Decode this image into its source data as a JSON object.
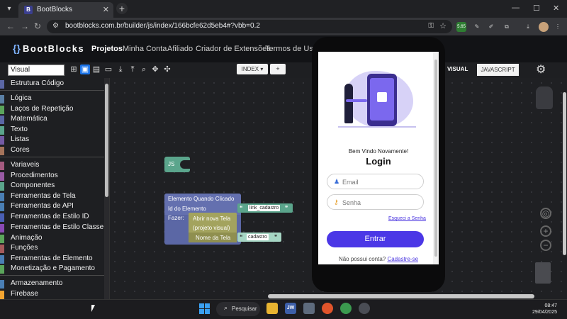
{
  "browser": {
    "tab_title": "BootBlocks",
    "favicon_letter": "B",
    "url": "bootblocks.com.br/builder/js/index/166bcfe62d5eb4#?vbb=0.2",
    "extension_badge": "5.65"
  },
  "header": {
    "brand": "BootBlocks",
    "menu": [
      "Projetos",
      "Minha Conta",
      "Afiliado",
      "Criador de Extensões",
      "Termos de Uso"
    ]
  },
  "toolbar": {
    "mode_value": "Visual",
    "index_label": "INDEX ▾",
    "plus_label": "+",
    "visual_tab": "VISUAL",
    "js_tab": "JAVASCRIPT"
  },
  "sidebar": {
    "items": [
      {
        "label": "Estrutura Código",
        "color": "#5b67a5"
      },
      {
        "label": "Lógica",
        "color": "#5b80a5"
      },
      {
        "label": "Laços de Repetição",
        "color": "#5ba55b"
      },
      {
        "label": "Matemática",
        "color": "#5b67a5"
      },
      {
        "label": "Texto",
        "color": "#5ba58c"
      },
      {
        "label": "Listas",
        "color": "#745ba5"
      },
      {
        "label": "Cores",
        "color": "#a5745b"
      },
      {
        "label": "Variaveis",
        "color": "#a55b80"
      },
      {
        "label": "Procedimentos",
        "color": "#995ba5"
      },
      {
        "label": "Componentes",
        "color": "#5ba58c"
      },
      {
        "label": "Ferramentas de Tela",
        "color": "#4a7fb5"
      },
      {
        "label": "Ferramentas de API",
        "color": "#4a7fb5"
      },
      {
        "label": "Ferramentas de Estilo ID",
        "color": "#4a5fb5"
      },
      {
        "label": "Ferramentas de Estilo Classe",
        "color": "#8a4ab5"
      },
      {
        "label": "Animação",
        "color": "#5ba55b"
      },
      {
        "label": "Funções",
        "color": "#a55b5b"
      },
      {
        "label": "Ferramentas de Elemento",
        "color": "#4a7fb5"
      },
      {
        "label": "Monetização e Pagamento",
        "color": "#5ba55b"
      },
      {
        "label": "Armazenamento",
        "color": "#4a7fb5"
      },
      {
        "label": "Firebase",
        "color": "#f2a531"
      }
    ]
  },
  "workspace": {
    "js_block": "JS",
    "event_block": {
      "title": "Elemento Quando Clicado",
      "id_label": "Id do Elemento",
      "id_value": "link_cadastro",
      "do_label": "Fazer:",
      "open_screen_line1": "Abrir nova Tela",
      "open_screen_line2": "(projeto visual)",
      "screen_name_label": "Nome da Tela",
      "screen_name_value": "cadastro"
    },
    "quote_open": "❝",
    "quote_close": "❞"
  },
  "preview": {
    "welcome": "Bem Vindo Novamente!",
    "title": "Login",
    "email_placeholder": "Email",
    "password_placeholder": "Senha",
    "forgot": "Esqueci a Senha",
    "submit": "Entrar",
    "no_account": "Não possui conta?",
    "signup_link": "Cadastre-se"
  },
  "taskbar": {
    "search": "Pesquisar",
    "time": "08:47",
    "date": "29/04/2025",
    "app_jw": "JW"
  }
}
